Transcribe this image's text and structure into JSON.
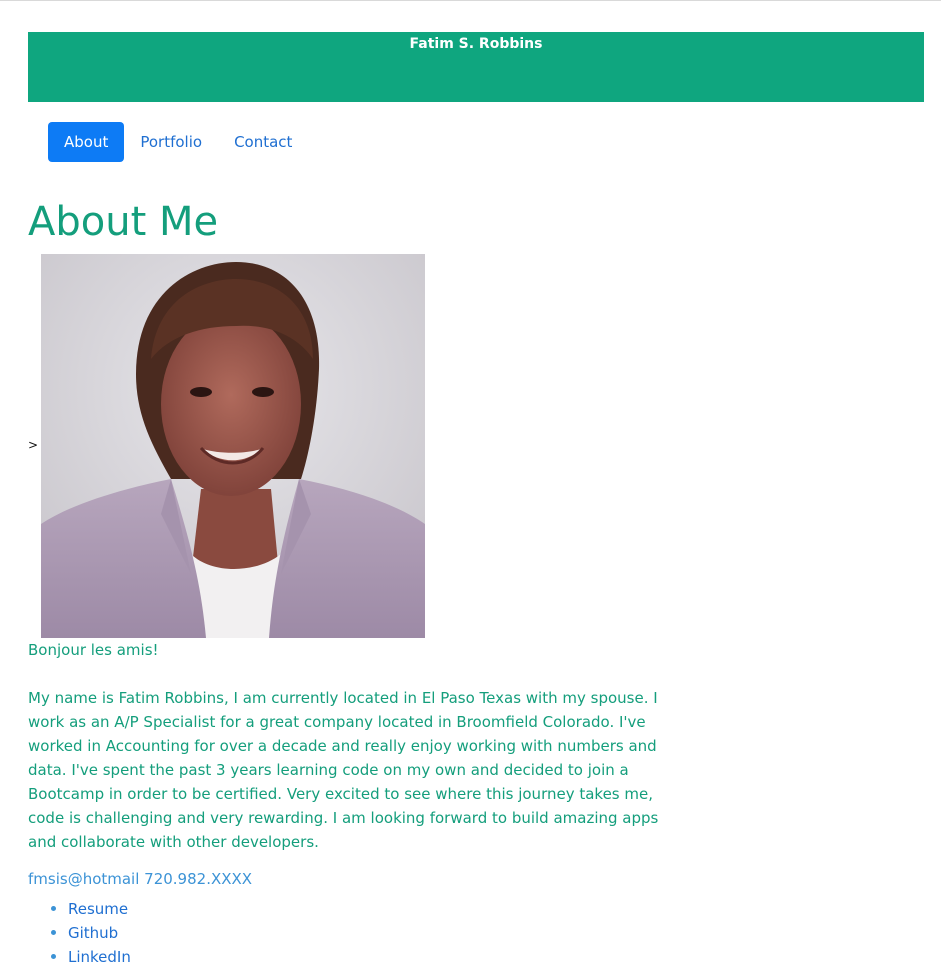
{
  "header": {
    "title": "Fatim S. Robbins",
    "background_color": "#0fa67f"
  },
  "nav": {
    "items": [
      {
        "label": "About",
        "active": true
      },
      {
        "label": "Portfolio",
        "active": false
      },
      {
        "label": "Contact",
        "active": false
      }
    ],
    "active_color": "#0d7bf5"
  },
  "main": {
    "title": "About Me",
    "stray_text": ">",
    "photo_alt": "Portrait photo",
    "greeting": "Bonjour les amis!",
    "bio": "My name is Fatim Robbins, I am currently located in El Paso Texas with my spouse. I work as an A/P Specialist for a great company located in Broomfield Colorado. I've worked in Accounting for over a decade and really enjoy working with numbers and data. I've spent the past 3 years learning code on my own and decided to join a Bootcamp in order to be certified. Very excited to see where this journey takes me, code is challenging and very rewarding. I am looking forward to build amazing apps and collaborate with other developers.",
    "contact": "fmsis@hotmail 720.982.XXXX",
    "links": [
      {
        "label": "Resume"
      },
      {
        "label": "Github"
      },
      {
        "label": "LinkedIn"
      }
    ],
    "accent_color": "#149e7c"
  }
}
